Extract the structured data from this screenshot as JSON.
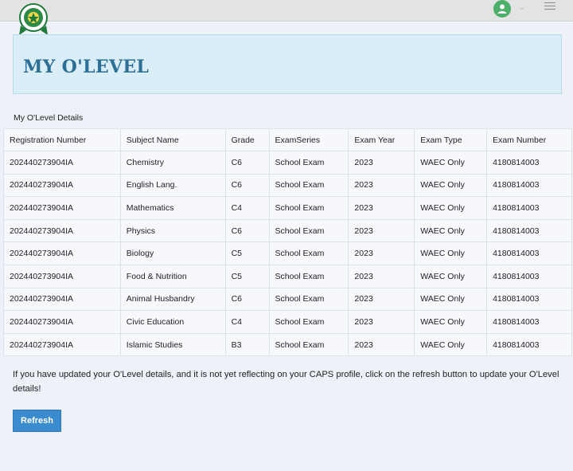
{
  "header": {
    "user_chevron": "⌄"
  },
  "page_title": "MY O'LEVEL",
  "section_label": "My O'Level Details",
  "table": {
    "columns": [
      "Registration Number",
      "Subject Name",
      "Grade",
      "ExamSeries",
      "Exam Year",
      "Exam Type",
      "Exam Number"
    ],
    "rows": [
      [
        "202440273904IA",
        "Chemistry",
        "C6",
        "School Exam",
        "2023",
        "WAEC Only",
        "4180814003"
      ],
      [
        "202440273904IA",
        "English Lang.",
        "C6",
        "School Exam",
        "2023",
        "WAEC Only",
        "4180814003"
      ],
      [
        "202440273904IA",
        "Mathematics",
        "C4",
        "School Exam",
        "2023",
        "WAEC Only",
        "4180814003"
      ],
      [
        "202440273904IA",
        "Physics",
        "C6",
        "School Exam",
        "2023",
        "WAEC Only",
        "4180814003"
      ],
      [
        "202440273904IA",
        "Biology",
        "C5",
        "School Exam",
        "2023",
        "WAEC Only",
        "4180814003"
      ],
      [
        "202440273904IA",
        "Food & Nutrition",
        "C5",
        "School Exam",
        "2023",
        "WAEC Only",
        "4180814003"
      ],
      [
        "202440273904IA",
        "Animal Husbandry",
        "C6",
        "School Exam",
        "2023",
        "WAEC Only",
        "4180814003"
      ],
      [
        "202440273904IA",
        "Civic Education",
        "C4",
        "School Exam",
        "2023",
        "WAEC Only",
        "4180814003"
      ],
      [
        "202440273904IA",
        "Islamic Studies",
        "B3",
        "School Exam",
        "2023",
        "WAEC Only",
        "4180814003"
      ]
    ]
  },
  "notice": "If you have updated your O'Level details, and it is not yet reflecting on your CAPS profile, click on the refresh button to update your O'Level details!",
  "refresh_label": "Refresh",
  "colors": {
    "header_bg": "#d9eef7",
    "title": "#2e6f96",
    "button": "#3b8ccf",
    "avatar": "#4caf6a"
  },
  "icons": {
    "logo": "jamb-crest-logo",
    "avatar": "user-icon",
    "menu": "hamburger-icon"
  }
}
